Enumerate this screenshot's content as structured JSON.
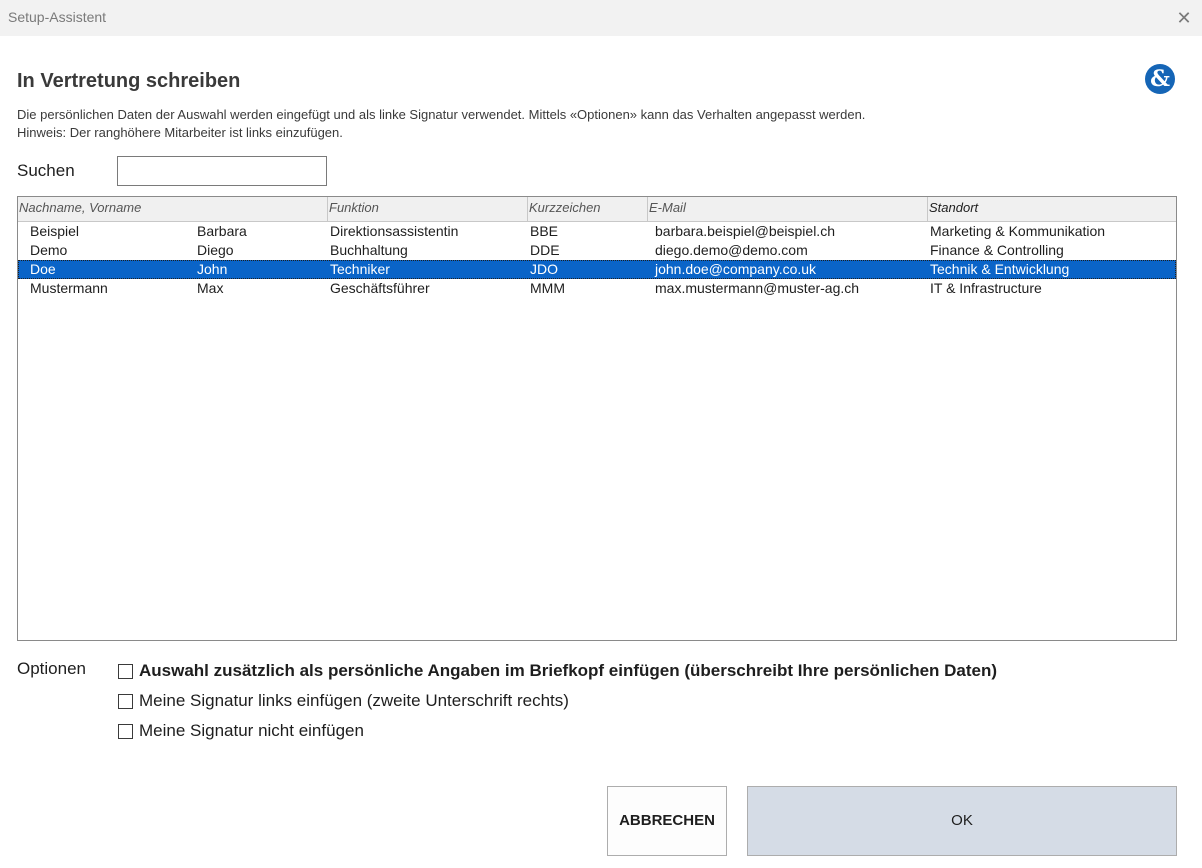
{
  "window": {
    "title": "Setup-Assistent",
    "close_symbol": "✕"
  },
  "heading": "In Vertretung schreiben",
  "logo": {
    "icon": "ampersand-logo-icon",
    "glyph": "&",
    "color": "#1565b6"
  },
  "description": {
    "line1": "Die persönlichen Daten der Auswahl werden eingefügt und als linke Signatur verwendet. Mittels «Optionen» kann das Verhalten angepasst werden.",
    "line2": "Hinweis: Der ranghöhere Mitarbeiter ist links einzufügen."
  },
  "search": {
    "label": "Suchen",
    "value": ""
  },
  "table": {
    "columns": [
      "Nachname, Vorname",
      "Funktion",
      "Kurzzeichen",
      "E-Mail",
      "Standort"
    ],
    "rows": [
      {
        "nachname": "Beispiel",
        "vorname": "Barbara",
        "funktion": "Direktionsassistentin",
        "kurzzeichen": "BBE",
        "email": "barbara.beispiel@beispiel.ch",
        "standort": "Marketing & Kommunikation"
      },
      {
        "nachname": "Demo",
        "vorname": "Diego",
        "funktion": "Buchhaltung",
        "kurzzeichen": "DDE",
        "email": "diego.demo@demo.com",
        "standort": "Finance & Controlling"
      },
      {
        "nachname": "Doe",
        "vorname": "John",
        "funktion": "Techniker",
        "kurzzeichen": "JDO",
        "email": "john.doe@company.co.uk",
        "standort": "Technik & Entwicklung"
      },
      {
        "nachname": "Mustermann",
        "vorname": "Max",
        "funktion": "Geschäftsführer",
        "kurzzeichen": "MMM",
        "email": "max.mustermann@muster-ag.ch",
        "standort": "IT & Infrastructure"
      }
    ],
    "selected_row": 2,
    "selection_color": "#0a64c8"
  },
  "options": {
    "label": "Optionen",
    "items": [
      {
        "label": "Auswahl zusätzlich  als persönliche Angaben im Briefkopf einfügen (überschreibt Ihre persönlichen Daten)",
        "checked": false,
        "bold": true
      },
      {
        "label": "Meine Signatur links einfügen (zweite Unterschrift rechts)",
        "checked": false,
        "bold": false
      },
      {
        "label": "Meine Signatur nicht einfügen",
        "checked": false,
        "bold": false
      }
    ]
  },
  "buttons": {
    "cancel": "ABBRECHEN",
    "ok": "OK"
  }
}
